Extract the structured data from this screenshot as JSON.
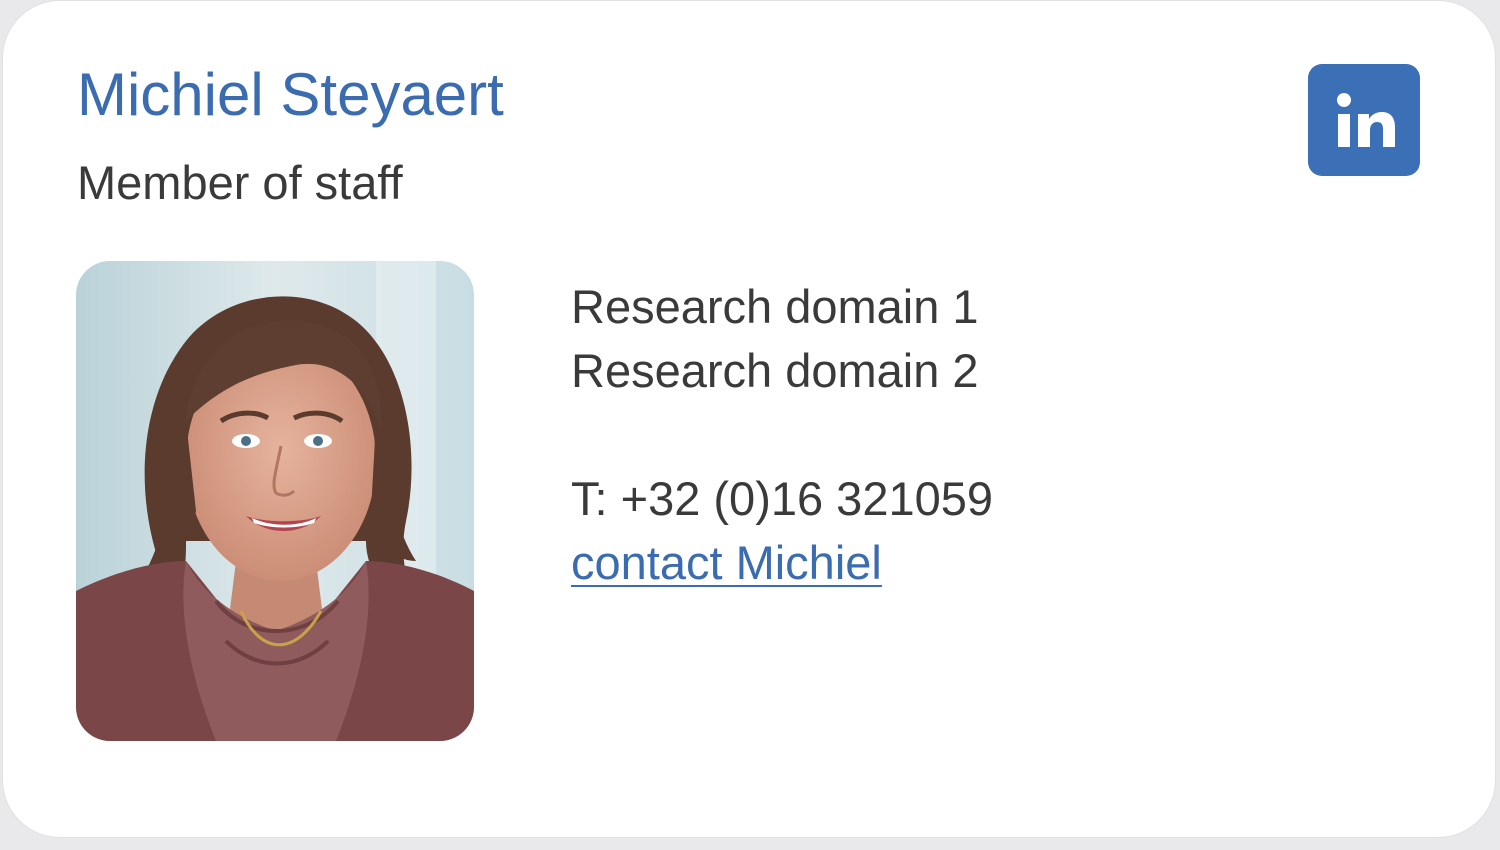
{
  "profile": {
    "name": "Michiel Steyaert",
    "role": "Member of staff"
  },
  "research": {
    "domain_1": "Research domain 1",
    "domain_2": "Research domain 2"
  },
  "contact": {
    "phone": "T: +32 (0)16 321059",
    "link_label": "contact Michiel"
  },
  "icons": {
    "linkedin": "linkedin-icon"
  },
  "colors": {
    "accent": "#3b6cb0",
    "linkedin_bg": "#3b6fb6",
    "text": "#3a3a3a"
  }
}
